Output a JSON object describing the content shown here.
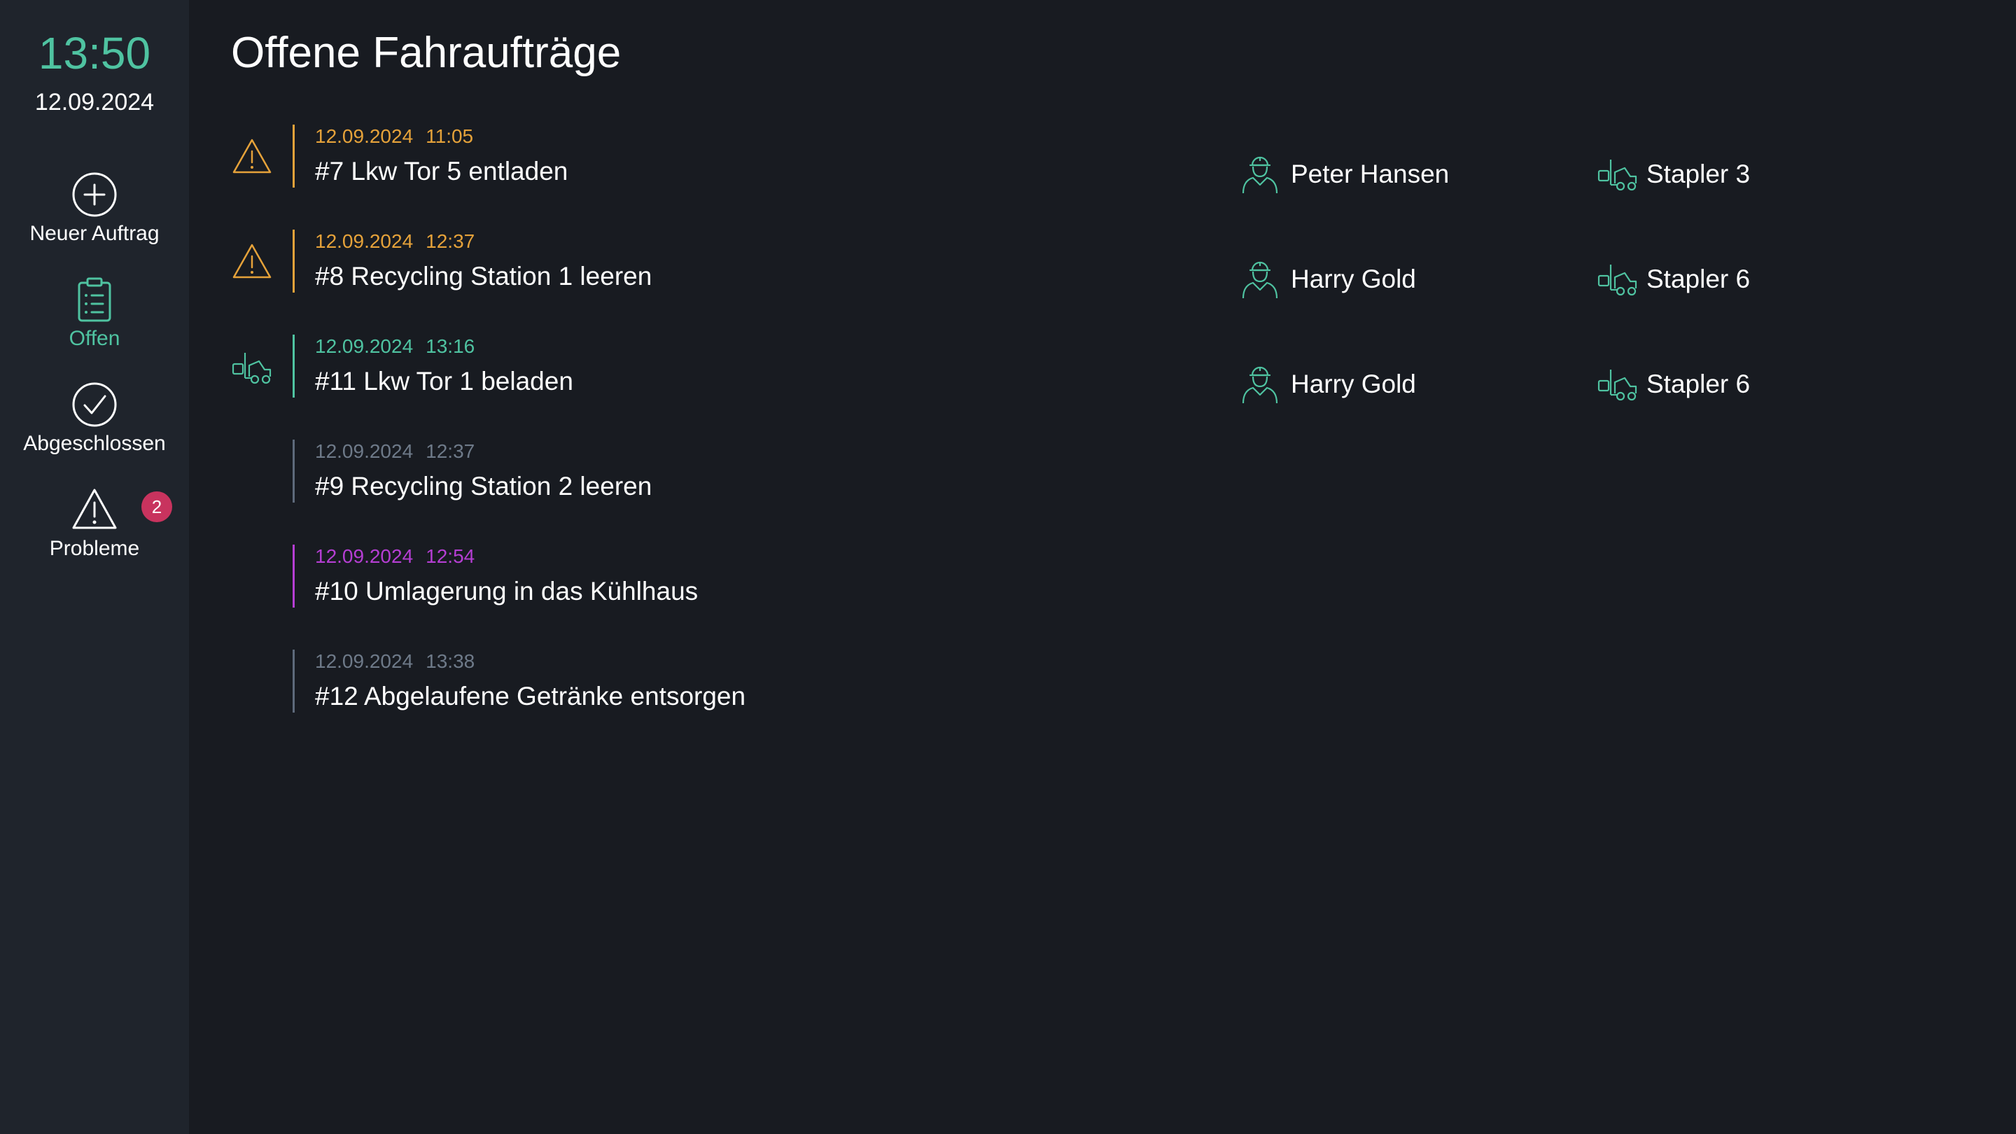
{
  "header": {
    "time": "13:50",
    "date": "12.09.2024"
  },
  "page": {
    "title": "Offene Fahraufträge"
  },
  "nav": {
    "new_order": "Neuer Auftrag",
    "open": "Offen",
    "closed": "Abgeschlossen",
    "problems": "Probleme",
    "problems_badge": "2"
  },
  "colors": {
    "accent": "#4fc3a1",
    "warning": "#e5a23a",
    "inactive": "#6e7a89",
    "purple": "#b53ed3",
    "badge": "#c8335e"
  },
  "orders": [
    {
      "date": "12.09.2024",
      "time": "11:05",
      "title": "#7 Lkw Tor 5 entladen",
      "status": "warning",
      "lead_icon": "warning-icon",
      "person": "Peter Hansen",
      "vehicle": "Stapler 3"
    },
    {
      "date": "12.09.2024",
      "time": "12:37",
      "title": "#8 Recycling Station 1 leeren",
      "status": "warning",
      "lead_icon": "warning-icon",
      "person": "Harry Gold",
      "vehicle": "Stapler 6"
    },
    {
      "date": "12.09.2024",
      "time": "13:16",
      "title": "#11 Lkw Tor 1 beladen",
      "status": "in-progress",
      "lead_icon": "forklift-icon",
      "person": "Harry Gold",
      "vehicle": "Stapler 6"
    },
    {
      "date": "12.09.2024",
      "time": "12:37",
      "title": "#9 Recycling Station 2 leeren",
      "status": "open"
    },
    {
      "date": "12.09.2024",
      "time": "12:54",
      "title": "#10 Umlagerung in das Kühlhaus",
      "status": "priority"
    },
    {
      "date": "12.09.2024",
      "time": "13:38",
      "title": "#12 Abgelaufene Getränke entsorgen",
      "status": "open"
    }
  ]
}
